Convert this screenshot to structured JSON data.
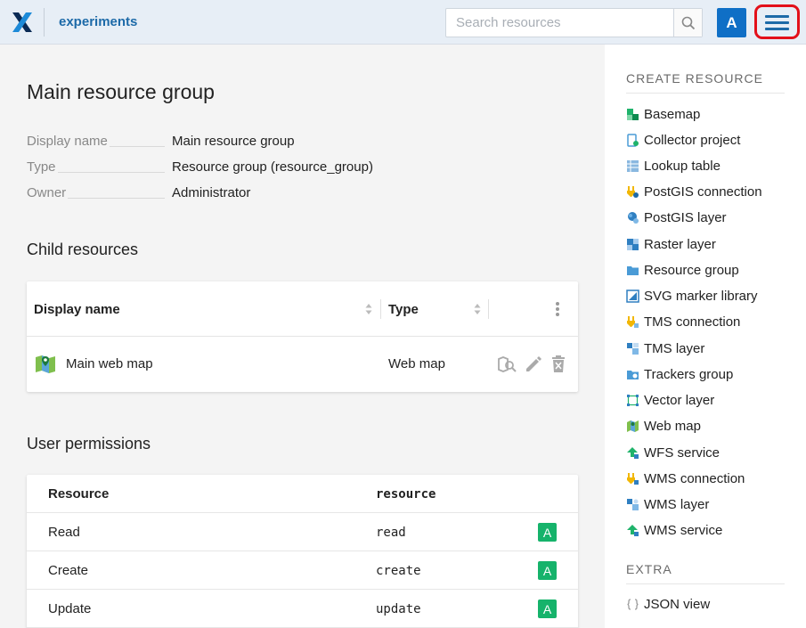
{
  "header": {
    "app_name": "experiments",
    "search_placeholder": "Search resources",
    "avatar_letter": "A",
    "colors": {
      "header_bg": "#e7eef6",
      "brand": "#1d6aa8",
      "avatar_bg": "#0f6fc6",
      "highlight": "#e3101a"
    }
  },
  "main": {
    "title": "Main resource group",
    "props": [
      {
        "key": "Display name",
        "value": "Main resource group"
      },
      {
        "key": "Type",
        "value": "Resource group (resource_group)"
      },
      {
        "key": "Owner",
        "value": "Administrator"
      }
    ],
    "child_title": "Child resources",
    "child_table": {
      "col_display_name": "Display name",
      "col_type": "Type",
      "rows": [
        {
          "name": "Main web map",
          "type": "Web map",
          "icon": "web-map-icon"
        }
      ]
    },
    "perm_title": "User permissions",
    "perm_table": {
      "col_resource": "Resource",
      "col_scope": "resource",
      "rows": [
        {
          "label": "Read",
          "code": "read",
          "badge": "A"
        },
        {
          "label": "Create",
          "code": "create",
          "badge": "A"
        },
        {
          "label": "Update",
          "code": "update",
          "badge": "A"
        }
      ]
    }
  },
  "sidebar": {
    "create_title": "CREATE RESOURCE",
    "create_items": [
      {
        "label": "Basemap",
        "icon": "basemap-icon"
      },
      {
        "label": "Collector project",
        "icon": "collector-project-icon"
      },
      {
        "label": "Lookup table",
        "icon": "lookup-table-icon"
      },
      {
        "label": "PostGIS connection",
        "icon": "postgis-connection-icon"
      },
      {
        "label": "PostGIS layer",
        "icon": "postgis-layer-icon"
      },
      {
        "label": "Raster layer",
        "icon": "raster-layer-icon"
      },
      {
        "label": "Resource group",
        "icon": "resource-group-icon"
      },
      {
        "label": "SVG marker library",
        "icon": "svg-marker-library-icon"
      },
      {
        "label": "TMS connection",
        "icon": "tms-connection-icon"
      },
      {
        "label": "TMS layer",
        "icon": "tms-layer-icon"
      },
      {
        "label": "Trackers group",
        "icon": "trackers-group-icon"
      },
      {
        "label": "Vector layer",
        "icon": "vector-layer-icon"
      },
      {
        "label": "Web map",
        "icon": "web-map-icon"
      },
      {
        "label": "WFS service",
        "icon": "wfs-service-icon"
      },
      {
        "label": "WMS connection",
        "icon": "wms-connection-icon"
      },
      {
        "label": "WMS layer",
        "icon": "wms-layer-icon"
      },
      {
        "label": "WMS service",
        "icon": "wms-service-icon"
      }
    ],
    "extra_title": "EXTRA",
    "extra_items": [
      {
        "label": "JSON view",
        "icon": "json-view-icon"
      }
    ]
  }
}
